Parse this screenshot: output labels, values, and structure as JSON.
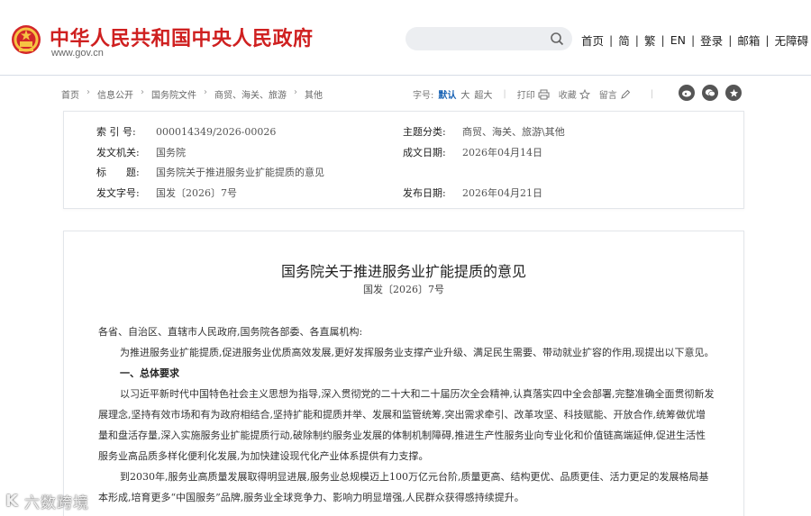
{
  "header": {
    "site_title": "中华人民共和国中央人民政府",
    "site_url": "www.gov.cn",
    "search": {
      "value": "",
      "placeholder": ""
    },
    "nav": [
      {
        "label": "首页"
      },
      {
        "label": "简"
      },
      {
        "label": "繁"
      },
      {
        "label": "EN"
      },
      {
        "label": "登录"
      },
      {
        "label": "邮箱"
      },
      {
        "label": "无障碍"
      }
    ]
  },
  "breadcrumb": [
    {
      "label": "首页"
    },
    {
      "label": "信息公开"
    },
    {
      "label": "国务院文件"
    },
    {
      "label": "商贸、海关、旅游"
    },
    {
      "label": "其他"
    }
  ],
  "tools": {
    "font_size_label": "字号:",
    "font_sizes": [
      "默认",
      "大",
      "超大"
    ],
    "print_label": "打印",
    "favorite_label": "收藏",
    "comment_label": "留言"
  },
  "meta": {
    "index_no": {
      "key": "索 引 号:",
      "value": "000014349/2026-00026"
    },
    "subject": {
      "key": "主题分类:",
      "value": "商贸、海关、旅游\\其他"
    },
    "issuer": {
      "key": "发文机关:",
      "value": "国务院"
    },
    "written_date": {
      "key": "成文日期:",
      "value": "2026年04月14日"
    },
    "title": {
      "key": "标　　题:",
      "value": "国务院关于推进服务业扩能提质的意见"
    },
    "doc_no": {
      "key": "发文字号:",
      "value": "国发〔2026〕7号"
    },
    "publish_date": {
      "key": "发布日期:",
      "value": "2026年04月21日"
    }
  },
  "article": {
    "title": "国务院关于推进服务业扩能提质的意见",
    "number": "国发〔2026〕7号",
    "salutation": "各省、自治区、直辖市人民政府,国务院各部委、各直属机构:",
    "intro": "为推进服务业扩能提质,促进服务业优质高效发展,更好发挥服务业支撑产业升级、满足民生需要、带动就业扩容的作用,现提出以下意见。",
    "section1": "一、总体要求",
    "para1": "以习近平新时代中国特色社会主义思想为指导,深入贯彻党的二十大和二十届历次全会精神,认真落实四中全会部署,完整准确全面贯彻新发展理念,坚持有效市场和有为政府相结合,坚持扩能和提质并举、发展和监管统筹,突出需求牵引、改革攻坚、科技赋能、开放合作,统筹做优增量和盘活存量,深入实施服务业扩能提质行动,破除制约服务业发展的体制机制障碍,推进生产性服务业向专业化和价值链高端延伸,促进生活性服务业高品质多样化便利化发展,为加快建设现代化产业体系提供有力支撑。",
    "para2": "到2030年,服务业高质量发展取得明显进展,服务业总规模迈上100万亿元台阶,质量更高、结构更优、品质更佳、活力更足的发展格局基本形成,培育更多“中国服务”品牌,服务业全球竞争力、影响力明显增强,人民群众获得感持续提升。"
  },
  "watermark": {
    "text": "六数跨境",
    "logo": "K"
  },
  "colors": {
    "brand_red": "#cf2020",
    "link_blue": "#1a64b5"
  }
}
